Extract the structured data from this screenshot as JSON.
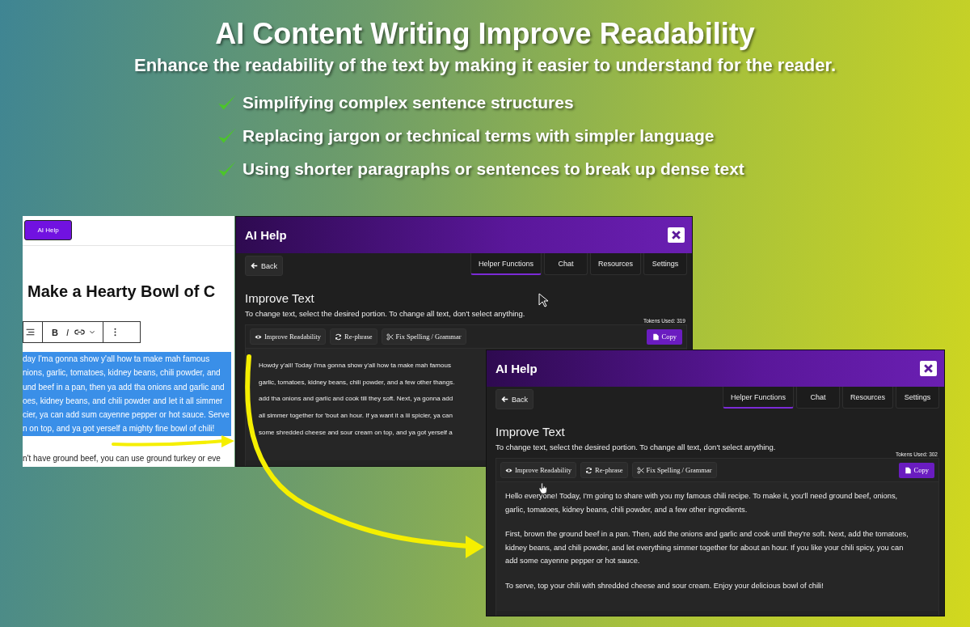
{
  "banner": {
    "title": "AI Content Writing Improve Readability",
    "subtitle": "Enhance the readability of the text by making it easier to understand for the reader.",
    "features": [
      "Simplifying complex sentence structures",
      "Replacing jargon or technical terms with simpler language",
      "Using shorter paragraphs or sentences to break up dense text"
    ]
  },
  "editor": {
    "ai_help_label": "AI Help",
    "post_title": "Make a Hearty Bowl of C",
    "bold_label": "B",
    "italic_label": "I",
    "selected_lines": [
      "day I'ma gonna show y'all how ta make mah famous",
      "nions, garlic, tomatoes, kidney beans, chili powder, and",
      "und beef in a pan, then ya add tha onions and garlic and",
      "oes, kidney beans, and chili powder and let it all simmer",
      "cier, ya can add sum cayenne pepper or hot sauce. Serve",
      "n on top, and ya got yerself a mighty fine bowl of chili!"
    ],
    "next_line": "n't have ground beef, you can use ground turkey or eve"
  },
  "dialogs": [
    {
      "title": "AI Help",
      "back_label": "Back",
      "tabs": [
        {
          "label": "Helper Functions",
          "selected": true
        },
        {
          "label": "Chat",
          "selected": false
        },
        {
          "label": "Resources",
          "selected": false
        },
        {
          "label": "Settings",
          "selected": false
        }
      ],
      "heading": "Improve Text",
      "hint": "To change text, select the desired portion. To change all text, don't select anything.",
      "tokens": "Tokens Used: 319",
      "actions": [
        {
          "label": "Improve Readability",
          "kind": "eye"
        },
        {
          "label": "Re-phrase",
          "kind": "refresh"
        },
        {
          "label": "Fix Spelling / Grammar",
          "kind": "scissors"
        }
      ],
      "copy_label": "Copy",
      "paragraphs": [
        [
          "Howdy y'all! Today I'ma gonna show y'all how ta make mah famous",
          "garlic, tomatoes, kidney beans, chili powder, and a few other thangs.",
          "add tha onions and garlic and cook till they soft. Next, ya gonna add",
          "all simmer together for 'bout an hour. If ya want it a lil spicier, ya can",
          "some shredded cheese and sour cream on top, and ya got yerself a"
        ]
      ]
    },
    {
      "title": "AI Help",
      "back_label": "Back",
      "tabs": [
        {
          "label": "Helper Functions",
          "selected": true
        },
        {
          "label": "Chat",
          "selected": false
        },
        {
          "label": "Resources",
          "selected": false
        },
        {
          "label": "Settings",
          "selected": false
        }
      ],
      "heading": "Improve Text",
      "hint": "To change text, select the desired portion. To change all text, don't select anything.",
      "tokens": "Tokens Used: 302",
      "actions": [
        {
          "label": "Improve Readability",
          "kind": "eye"
        },
        {
          "label": "Re-phrase",
          "kind": "refresh"
        },
        {
          "label": "Fix Spelling / Grammar",
          "kind": "scissors"
        }
      ],
      "copy_label": "Copy",
      "paragraphs": [
        [
          "Hello everyone! Today, I'm going to share with you my famous chili recipe. To make it, you'll need ground beef, onions,",
          "garlic, tomatoes, kidney beans, chili powder, and a few other ingredients."
        ],
        [
          "First, brown the ground beef in a pan. Then, add the onions and garlic and cook until they're soft. Next, add the tomatoes,",
          "kidney beans, and chili powder, and let everything simmer together for about an hour. If you like your chili spicy, you can",
          "add some cayenne pepper or hot sauce."
        ],
        [
          "To serve, top your chili with shredded cheese and sour cream. Enjoy your delicious bowl of chili!"
        ]
      ]
    }
  ]
}
